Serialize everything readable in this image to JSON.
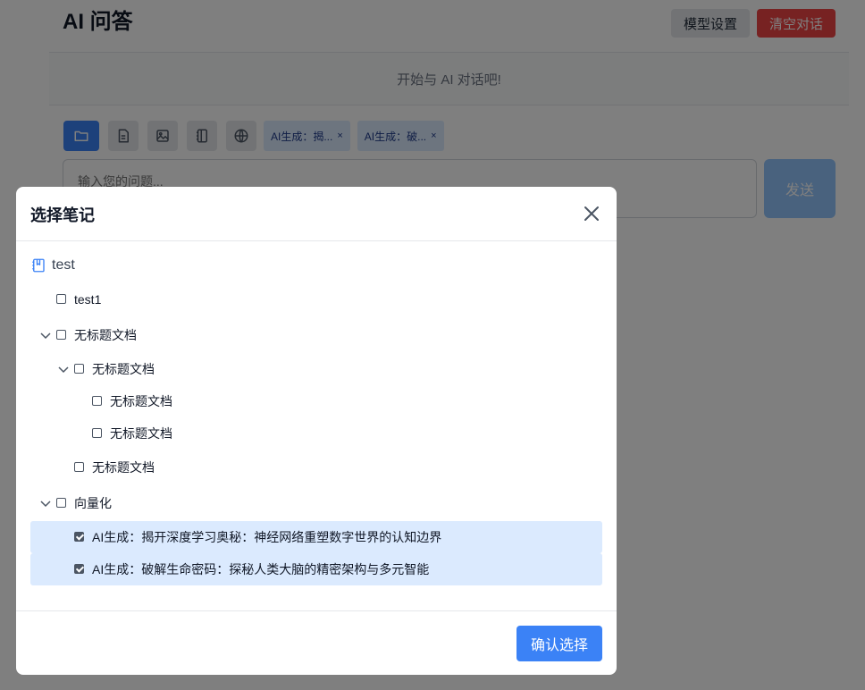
{
  "app": {
    "title": "AI 问答",
    "model_settings_label": "模型设置",
    "clear_chat_label": "清空对话",
    "chat_empty_text": "开始与 AI 对话吧!",
    "input_placeholder": "输入您的问题...",
    "send_label": "发送",
    "tools": [
      "folder-icon",
      "document-icon",
      "image-icon",
      "notebook-icon",
      "globe-icon"
    ],
    "chips": [
      {
        "label": "AI生成：揭...",
        "close": "×"
      },
      {
        "label": "AI生成：破...",
        "close": "×"
      }
    ]
  },
  "modal": {
    "title": "选择笔记",
    "notebook": "test",
    "nodes": [
      {
        "label": "test1",
        "level": 0,
        "expandable": false,
        "checked": false
      },
      {
        "label": "无标题文档",
        "level": 0,
        "expandable": true,
        "checked": false
      },
      {
        "label": "无标题文档",
        "level": 1,
        "expandable": true,
        "checked": false
      },
      {
        "label": "无标题文档",
        "level": 2,
        "expandable": false,
        "checked": false
      },
      {
        "label": "无标题文档",
        "level": 2,
        "expandable": false,
        "checked": false
      },
      {
        "label": "无标题文档",
        "level": 1,
        "expandable": false,
        "checked": false
      },
      {
        "label": "向量化",
        "level": 0,
        "expandable": true,
        "checked": false
      },
      {
        "label": "AI生成：揭开深度学习奥秘：神经网络重塑数字世界的认知边界",
        "level": 1,
        "expandable": false,
        "checked": true
      },
      {
        "label": "AI生成：破解生命密码：探秘人类大脑的精密架构与多元智能",
        "level": 1,
        "expandable": false,
        "checked": true
      }
    ],
    "confirm_label": "确认选择"
  },
  "colors": {
    "primary": "#3b82f6",
    "danger": "#ef4444",
    "selected_bg": "#dbeafe"
  }
}
